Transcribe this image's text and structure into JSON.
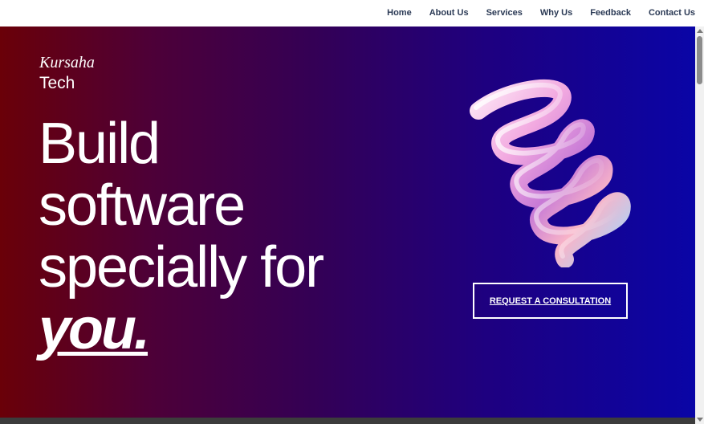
{
  "nav": {
    "items": [
      {
        "label": "Home"
      },
      {
        "label": "About Us"
      },
      {
        "label": "Services"
      },
      {
        "label": "Why Us"
      },
      {
        "label": "Feedback"
      },
      {
        "label": "Contact Us"
      }
    ]
  },
  "brand": {
    "script": "Kursaha",
    "word": "Tech"
  },
  "hero": {
    "headline_lines": [
      "Build",
      "software",
      "specially for"
    ],
    "headline_emphasis": "you.",
    "cta_label": "REQUEST A CONSULTATION",
    "image_icon": "spring-3d-icon"
  },
  "colors": {
    "gradient_start": "#6a0008",
    "gradient_end": "#0a05a6",
    "nav_text": "#2b3a55"
  }
}
